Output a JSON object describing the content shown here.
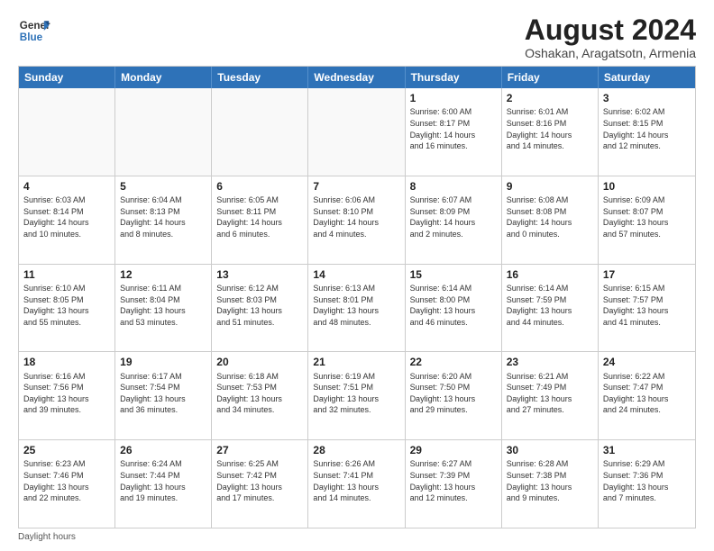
{
  "header": {
    "logo_line1": "General",
    "logo_line2": "Blue",
    "month_year": "August 2024",
    "location": "Oshakan, Aragatsotn, Armenia"
  },
  "days_of_week": [
    "Sunday",
    "Monday",
    "Tuesday",
    "Wednesday",
    "Thursday",
    "Friday",
    "Saturday"
  ],
  "footer": {
    "daylight_label": "Daylight hours"
  },
  "weeks": [
    [
      {
        "day": "",
        "info": "",
        "empty": true
      },
      {
        "day": "",
        "info": "",
        "empty": true
      },
      {
        "day": "",
        "info": "",
        "empty": true
      },
      {
        "day": "",
        "info": "",
        "empty": true
      },
      {
        "day": "1",
        "info": "Sunrise: 6:00 AM\nSunset: 8:17 PM\nDaylight: 14 hours\nand 16 minutes."
      },
      {
        "day": "2",
        "info": "Sunrise: 6:01 AM\nSunset: 8:16 PM\nDaylight: 14 hours\nand 14 minutes."
      },
      {
        "day": "3",
        "info": "Sunrise: 6:02 AM\nSunset: 8:15 PM\nDaylight: 14 hours\nand 12 minutes."
      }
    ],
    [
      {
        "day": "4",
        "info": "Sunrise: 6:03 AM\nSunset: 8:14 PM\nDaylight: 14 hours\nand 10 minutes."
      },
      {
        "day": "5",
        "info": "Sunrise: 6:04 AM\nSunset: 8:13 PM\nDaylight: 14 hours\nand 8 minutes."
      },
      {
        "day": "6",
        "info": "Sunrise: 6:05 AM\nSunset: 8:11 PM\nDaylight: 14 hours\nand 6 minutes."
      },
      {
        "day": "7",
        "info": "Sunrise: 6:06 AM\nSunset: 8:10 PM\nDaylight: 14 hours\nand 4 minutes."
      },
      {
        "day": "8",
        "info": "Sunrise: 6:07 AM\nSunset: 8:09 PM\nDaylight: 14 hours\nand 2 minutes."
      },
      {
        "day": "9",
        "info": "Sunrise: 6:08 AM\nSunset: 8:08 PM\nDaylight: 14 hours\nand 0 minutes."
      },
      {
        "day": "10",
        "info": "Sunrise: 6:09 AM\nSunset: 8:07 PM\nDaylight: 13 hours\nand 57 minutes."
      }
    ],
    [
      {
        "day": "11",
        "info": "Sunrise: 6:10 AM\nSunset: 8:05 PM\nDaylight: 13 hours\nand 55 minutes."
      },
      {
        "day": "12",
        "info": "Sunrise: 6:11 AM\nSunset: 8:04 PM\nDaylight: 13 hours\nand 53 minutes."
      },
      {
        "day": "13",
        "info": "Sunrise: 6:12 AM\nSunset: 8:03 PM\nDaylight: 13 hours\nand 51 minutes."
      },
      {
        "day": "14",
        "info": "Sunrise: 6:13 AM\nSunset: 8:01 PM\nDaylight: 13 hours\nand 48 minutes."
      },
      {
        "day": "15",
        "info": "Sunrise: 6:14 AM\nSunset: 8:00 PM\nDaylight: 13 hours\nand 46 minutes."
      },
      {
        "day": "16",
        "info": "Sunrise: 6:14 AM\nSunset: 7:59 PM\nDaylight: 13 hours\nand 44 minutes."
      },
      {
        "day": "17",
        "info": "Sunrise: 6:15 AM\nSunset: 7:57 PM\nDaylight: 13 hours\nand 41 minutes."
      }
    ],
    [
      {
        "day": "18",
        "info": "Sunrise: 6:16 AM\nSunset: 7:56 PM\nDaylight: 13 hours\nand 39 minutes."
      },
      {
        "day": "19",
        "info": "Sunrise: 6:17 AM\nSunset: 7:54 PM\nDaylight: 13 hours\nand 36 minutes."
      },
      {
        "day": "20",
        "info": "Sunrise: 6:18 AM\nSunset: 7:53 PM\nDaylight: 13 hours\nand 34 minutes."
      },
      {
        "day": "21",
        "info": "Sunrise: 6:19 AM\nSunset: 7:51 PM\nDaylight: 13 hours\nand 32 minutes."
      },
      {
        "day": "22",
        "info": "Sunrise: 6:20 AM\nSunset: 7:50 PM\nDaylight: 13 hours\nand 29 minutes."
      },
      {
        "day": "23",
        "info": "Sunrise: 6:21 AM\nSunset: 7:49 PM\nDaylight: 13 hours\nand 27 minutes."
      },
      {
        "day": "24",
        "info": "Sunrise: 6:22 AM\nSunset: 7:47 PM\nDaylight: 13 hours\nand 24 minutes."
      }
    ],
    [
      {
        "day": "25",
        "info": "Sunrise: 6:23 AM\nSunset: 7:46 PM\nDaylight: 13 hours\nand 22 minutes."
      },
      {
        "day": "26",
        "info": "Sunrise: 6:24 AM\nSunset: 7:44 PM\nDaylight: 13 hours\nand 19 minutes."
      },
      {
        "day": "27",
        "info": "Sunrise: 6:25 AM\nSunset: 7:42 PM\nDaylight: 13 hours\nand 17 minutes."
      },
      {
        "day": "28",
        "info": "Sunrise: 6:26 AM\nSunset: 7:41 PM\nDaylight: 13 hours\nand 14 minutes."
      },
      {
        "day": "29",
        "info": "Sunrise: 6:27 AM\nSunset: 7:39 PM\nDaylight: 13 hours\nand 12 minutes."
      },
      {
        "day": "30",
        "info": "Sunrise: 6:28 AM\nSunset: 7:38 PM\nDaylight: 13 hours\nand 9 minutes."
      },
      {
        "day": "31",
        "info": "Sunrise: 6:29 AM\nSunset: 7:36 PM\nDaylight: 13 hours\nand 7 minutes."
      }
    ]
  ]
}
